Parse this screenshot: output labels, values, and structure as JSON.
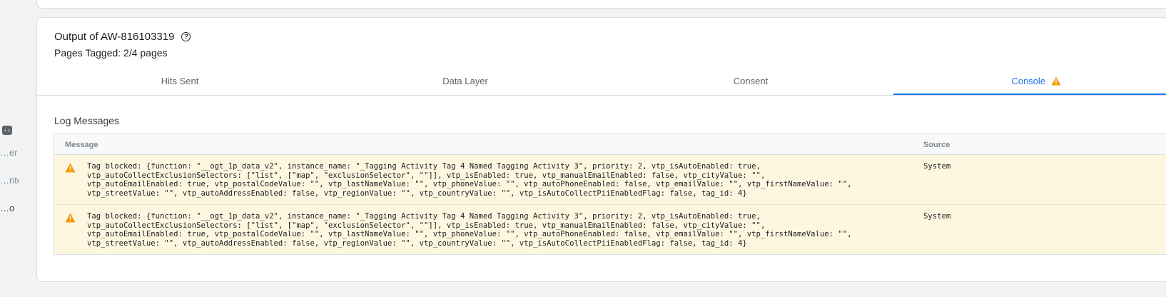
{
  "left_rail": {
    "code_icon": "code-icon",
    "items": [
      "…er…",
      "…nto…",
      "…o …"
    ]
  },
  "output": {
    "title": "Output of AW-816103319",
    "help_icon": "help-circle-icon",
    "pages_tagged": "Pages Tagged: 2/4 pages"
  },
  "tabs": [
    {
      "label": "Hits Sent",
      "active": false
    },
    {
      "label": "Data Layer",
      "active": false
    },
    {
      "label": "Consent",
      "active": false
    },
    {
      "label": "Console",
      "active": true,
      "icon": "warning-icon"
    }
  ],
  "log": {
    "title": "Log Messages",
    "columns": {
      "message": "Message",
      "source": "Source"
    },
    "rows": [
      {
        "icon": "warning-icon",
        "message": "Tag blocked: {function: \"__ogt_1p_data_v2\", instance_name: \"_Tagging Activity Tag 4 Named Tagging Activity 3\", priority: 2, vtp_isAutoEnabled: true,\nvtp_autoCollectExclusionSelectors: [\"list\", [\"map\", \"exclusionSelector\", \"\"]], vtp_isEnabled: true, vtp_manualEmailEnabled: false, vtp_cityValue: \"\",\nvtp_autoEmailEnabled: true, vtp_postalCodeValue: \"\", vtp_lastNameValue: \"\", vtp_phoneValue: \"\", vtp_autoPhoneEnabled: false, vtp_emailValue: \"\", vtp_firstNameValue: \"\",\nvtp_streetValue: \"\", vtp_autoAddressEnabled: false, vtp_regionValue: \"\", vtp_countryValue: \"\", vtp_isAutoCollectPiiEnabledFlag: false, tag_id: 4}",
        "source": "System"
      },
      {
        "icon": "warning-icon",
        "message": "Tag blocked: {function: \"__ogt_1p_data_v2\", instance_name: \"_Tagging Activity Tag 4 Named Tagging Activity 3\", priority: 2, vtp_isAutoEnabled: true,\nvtp_autoCollectExclusionSelectors: [\"list\", [\"map\", \"exclusionSelector\", \"\"]], vtp_isEnabled: true, vtp_manualEmailEnabled: false, vtp_cityValue: \"\",\nvtp_autoEmailEnabled: true, vtp_postalCodeValue: \"\", vtp_lastNameValue: \"\", vtp_phoneValue: \"\", vtp_autoPhoneEnabled: false, vtp_emailValue: \"\", vtp_firstNameValue: \"\",\nvtp_streetValue: \"\", vtp_autoAddressEnabled: false, vtp_regionValue: \"\", vtp_countryValue: \"\", vtp_isAutoCollectPiiEnabledFlag: false, tag_id: 4}",
        "source": "System"
      }
    ]
  },
  "colors": {
    "accent": "#1a73e8",
    "warning": "#f29900",
    "warning_row_bg": "#fef7e0"
  }
}
